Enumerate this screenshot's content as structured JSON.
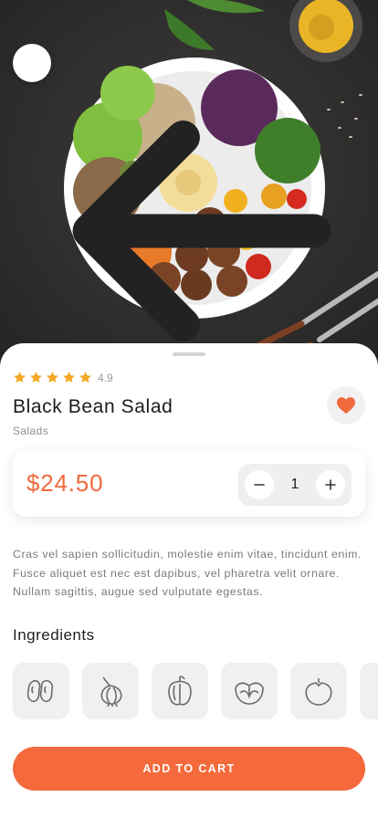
{
  "header": {
    "back_icon": "arrow-left-icon"
  },
  "hero": {
    "image": "salad-bowl-photo"
  },
  "product": {
    "rating": "4.9",
    "stars": 5,
    "name": "Black Bean Salad",
    "category": "Salads",
    "favorite": true,
    "price": "$24.50",
    "quantity": "1",
    "description": "Cras vel sapien sollicitudin, molestie enim vitae, tincidunt enim. Fusce aliquet est nec est dapibus, vel pharetra velit ornare. Nullam sagittis, augue sed vulputate egestas."
  },
  "ingredients": {
    "title": "Ingredients",
    "items": [
      "beans-icon",
      "onion-icon",
      "bell-pepper-icon",
      "cabbage-icon",
      "tomato-icon",
      "partial-ingredient-icon"
    ]
  },
  "actions": {
    "add_to_cart": "ADD TO CART"
  },
  "colors": {
    "accent": "#f46a3c",
    "star": "#f5a623",
    "favorite": "#f06a3e"
  }
}
